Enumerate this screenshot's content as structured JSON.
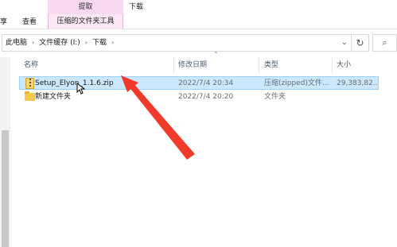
{
  "ribbon": {
    "contextual_group": "提取",
    "contextual_tab": "压缩的文件夹工具",
    "window_title": "下载",
    "tabs": [
      "享",
      "查看"
    ]
  },
  "address": {
    "crumbs": [
      "此电脑",
      "文件缓存 (I:)",
      "下载"
    ],
    "dropdown_icon": "chevron-down-icon",
    "refresh_icon": "refresh-icon",
    "search_icon": "search-icon"
  },
  "columns": {
    "name": "名称",
    "modified": "修改日期",
    "type": "类型",
    "size": "大小"
  },
  "files": [
    {
      "name": "Setup_Elyon_1.1.6.zip",
      "modified": "2022/7/4 20:34",
      "type": "压缩(zipped)文件...",
      "size": "29,383,82...",
      "icon": "zip-icon",
      "selected": true
    },
    {
      "name": "新建文件夹",
      "modified": "2022/7/4 20:20",
      "type": "文件夹",
      "size": "",
      "icon": "folder-icon",
      "selected": false
    }
  ],
  "colors": {
    "selection_bg": "#cce8ff",
    "annotation_arrow": "#f23a2a",
    "context_tab": "#fbe8f6"
  }
}
